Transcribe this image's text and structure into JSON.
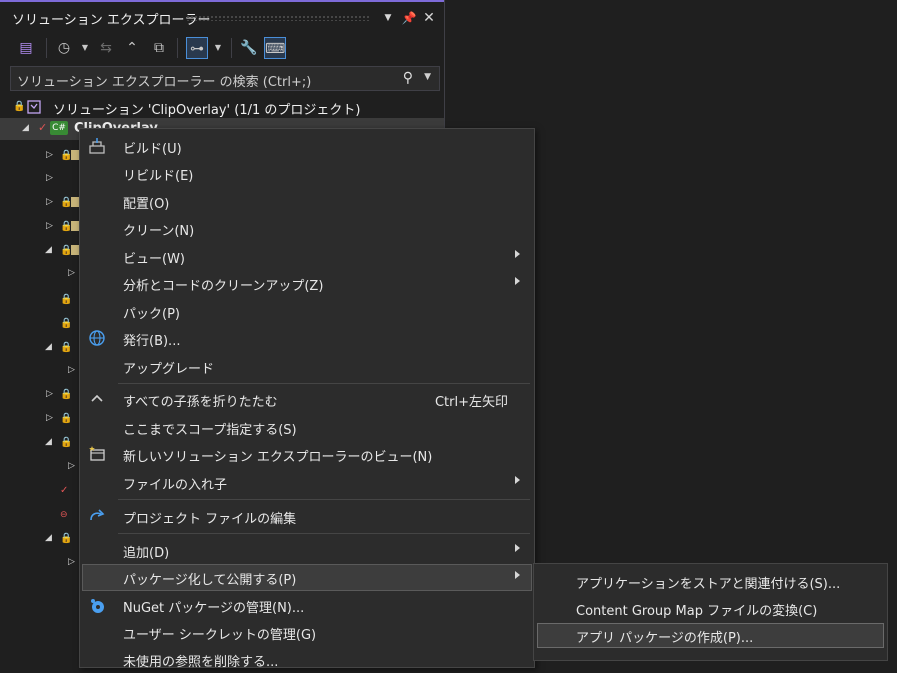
{
  "panel": {
    "title": "ソリューション エクスプローラー",
    "search_placeholder": "ソリューション エクスプローラー の検索 (Ctrl+;)",
    "solution_label": "ソリューション 'ClipOverlay' (1/1 のプロジェクト)",
    "project_label": "ClipOverlay",
    "project_badge": "C#"
  },
  "menu": {
    "items": [
      {
        "label": "ビルド(U)"
      },
      {
        "label": "リビルド(E)"
      },
      {
        "label": "配置(O)"
      },
      {
        "label": "クリーン(N)"
      },
      {
        "label": "ビュー(W)"
      },
      {
        "label": "分析とコードのクリーンアップ(Z)"
      },
      {
        "label": "パック(P)"
      },
      {
        "label": "発行(B)..."
      },
      {
        "label": "アップグレード"
      },
      {
        "label": "すべての子孫を折りたたむ",
        "shortcut": "Ctrl+左矢印"
      },
      {
        "label": "ここまでスコープ指定する(S)"
      },
      {
        "label": "新しいソリューション エクスプローラーのビュー(N)"
      },
      {
        "label": "ファイルの入れ子"
      },
      {
        "label": "プロジェクト ファイルの編集"
      },
      {
        "label": "追加(D)"
      },
      {
        "label": "パッケージ化して公開する(P)"
      },
      {
        "label": "NuGet パッケージの管理(N)..."
      },
      {
        "label": "ユーザー シークレットの管理(G)"
      },
      {
        "label": "未使用の参照を削除する..."
      }
    ]
  },
  "submenu": {
    "items": [
      {
        "label": "アプリケーションをストアと関連付ける(S)..."
      },
      {
        "label": "Content Group Map ファイルの変換(C)"
      },
      {
        "label": "アプリ パッケージの作成(P)..."
      }
    ]
  },
  "colors": {
    "accent": "#7e6bd9",
    "background": "#1f1f1f",
    "menu": "#2c2c2c"
  }
}
